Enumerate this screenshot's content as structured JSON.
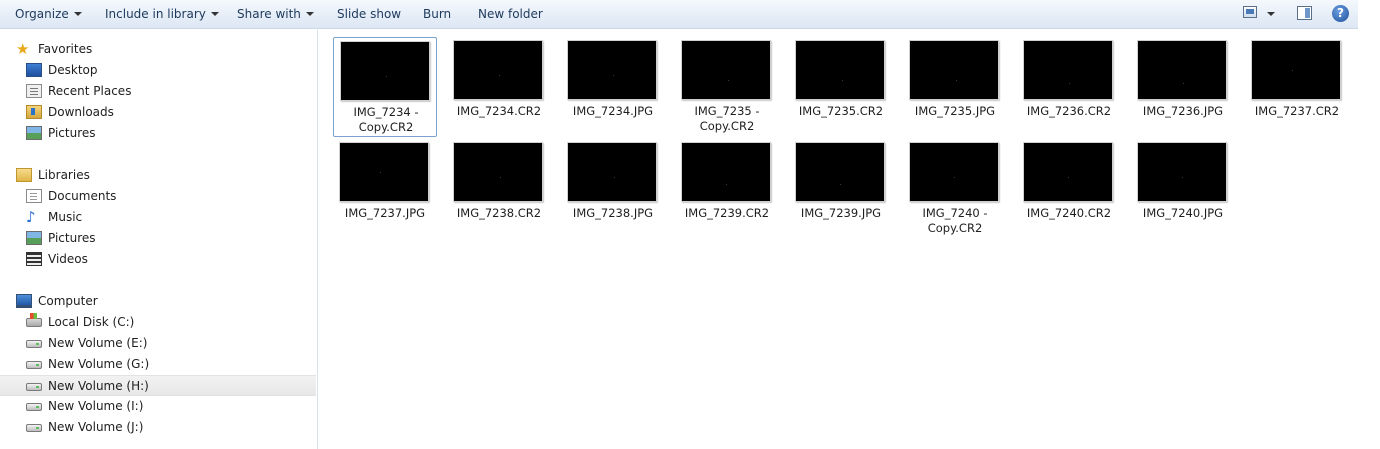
{
  "toolbar": {
    "organize": "Organize",
    "include_in_library": "Include in library",
    "share_with": "Share with",
    "slide_show": "Slide show",
    "burn": "Burn",
    "new_folder": "New folder",
    "help_glyph": "?"
  },
  "nav": {
    "favorites": {
      "label": "Favorites",
      "icon": "star-icon"
    },
    "favorites_items": [
      {
        "label": "Desktop",
        "icon": "desktop-icon"
      },
      {
        "label": "Recent Places",
        "icon": "recent-places-icon"
      },
      {
        "label": "Downloads",
        "icon": "downloads-icon"
      },
      {
        "label": "Pictures",
        "icon": "pictures-icon"
      }
    ],
    "libraries": {
      "label": "Libraries",
      "icon": "libraries-icon"
    },
    "libraries_items": [
      {
        "label": "Documents",
        "icon": "documents-icon"
      },
      {
        "label": "Music",
        "icon": "music-icon"
      },
      {
        "label": "Pictures",
        "icon": "pictures-icon"
      },
      {
        "label": "Videos",
        "icon": "videos-icon"
      }
    ],
    "computer": {
      "label": "Computer",
      "icon": "computer-icon"
    },
    "computer_items": [
      {
        "label": "Local Disk (C:)",
        "icon": "local-disk-icon"
      },
      {
        "label": "New Volume (E:)",
        "icon": "drive-icon"
      },
      {
        "label": "New Volume (G:)",
        "icon": "drive-icon"
      },
      {
        "label": "New Volume (H:)",
        "icon": "drive-icon",
        "selected": true
      },
      {
        "label": "New Volume (I:)",
        "icon": "drive-icon"
      },
      {
        "label": "New Volume (J:)",
        "icon": "drive-icon"
      }
    ]
  },
  "files": [
    {
      "name": "IMG_7234 - Copy.CR2",
      "selected": true
    },
    {
      "name": "IMG_7234.CR2"
    },
    {
      "name": "IMG_7234.JPG"
    },
    {
      "name": "IMG_7235 - Copy.CR2"
    },
    {
      "name": "IMG_7235.CR2"
    },
    {
      "name": "IMG_7235.JPG"
    },
    {
      "name": "IMG_7236.CR2"
    },
    {
      "name": "IMG_7236.JPG"
    },
    {
      "name": "IMG_7237.CR2"
    },
    {
      "name": "IMG_7237.JPG"
    },
    {
      "name": "IMG_7238.CR2"
    },
    {
      "name": "IMG_7238.JPG"
    },
    {
      "name": "IMG_7239.CR2"
    },
    {
      "name": "IMG_7239.JPG"
    },
    {
      "name": "IMG_7240 - Copy.CR2"
    },
    {
      "name": "IMG_7240.CR2"
    },
    {
      "name": "IMG_7240.JPG"
    }
  ]
}
